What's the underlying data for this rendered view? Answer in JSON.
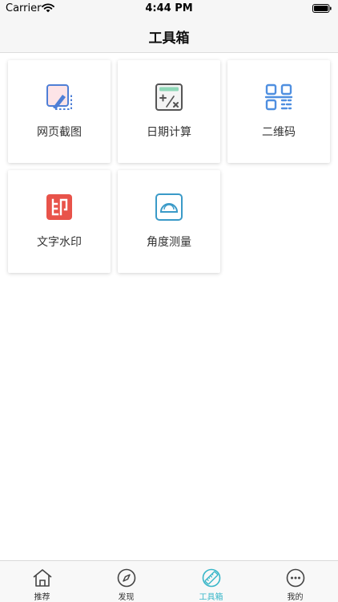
{
  "status_bar": {
    "carrier": "Carrier",
    "time": "4:44 PM"
  },
  "nav": {
    "title": "工具箱"
  },
  "tools": [
    {
      "label": "网页截图",
      "icon": "webpage-screenshot-icon"
    },
    {
      "label": "日期计算",
      "icon": "calculator-icon"
    },
    {
      "label": "二维码",
      "icon": "qr-code-icon"
    },
    {
      "label": "文字水印",
      "icon": "watermark-stamp-icon"
    },
    {
      "label": "角度测量",
      "icon": "protractor-icon"
    }
  ],
  "tab_bar": {
    "items": [
      {
        "label": "推荐",
        "icon": "home-icon"
      },
      {
        "label": "发现",
        "icon": "compass-icon"
      },
      {
        "label": "工具箱",
        "icon": "ruler-icon",
        "active": true
      },
      {
        "label": "我的",
        "icon": "more-icon"
      }
    ]
  },
  "colors": {
    "accent": "#38b6c8",
    "stamp_red": "#e8534a",
    "qr_blue": "#4f8fe0",
    "calc_green": "#8fd8b8"
  }
}
